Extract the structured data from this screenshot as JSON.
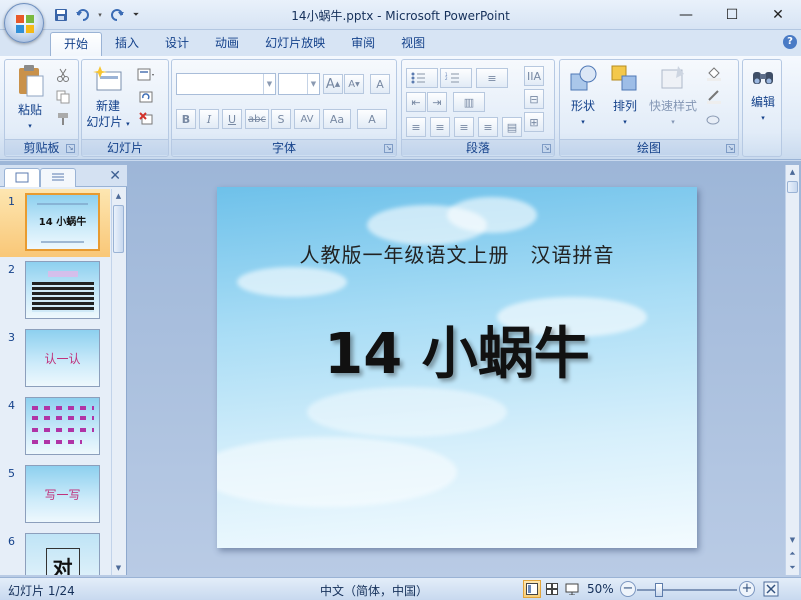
{
  "window": {
    "title": "14小蜗牛.pptx - Microsoft PowerPoint",
    "controls": [
      "minimize-icon",
      "maximize-icon",
      "close-icon"
    ]
  },
  "quick_access": [
    "save-icon",
    "undo-icon",
    "redo-icon",
    "customize-icon"
  ],
  "tabs": [
    {
      "label": "开始",
      "active": true
    },
    {
      "label": "插入",
      "active": false
    },
    {
      "label": "设计",
      "active": false
    },
    {
      "label": "动画",
      "active": false
    },
    {
      "label": "幻灯片放映",
      "active": false
    },
    {
      "label": "审阅",
      "active": false
    },
    {
      "label": "视图",
      "active": false
    }
  ],
  "ribbon": {
    "clipboard": {
      "label": "剪贴板",
      "paste": "粘贴"
    },
    "slides": {
      "label": "幻灯片",
      "new_slide_line1": "新建",
      "new_slide_line2": "幻灯片"
    },
    "font": {
      "label": "字体",
      "font_name": "",
      "font_size": "",
      "bold": "B",
      "italic": "I",
      "underline": "U",
      "strike": "abc",
      "shadow": "S",
      "spacing": "AV",
      "case": "Aa",
      "grow": "A",
      "shrink": "A",
      "color": "A"
    },
    "paragraph": {
      "label": "段落"
    },
    "drawing": {
      "label": "绘图",
      "shapes": "形状",
      "arrange": "排列",
      "quick_styles": "快速样式"
    },
    "editing": {
      "label": "编辑"
    }
  },
  "thumbnails": [
    {
      "number": "1",
      "active": true,
      "title": "14 小蜗牛"
    },
    {
      "number": "2",
      "active": false,
      "title": ""
    },
    {
      "number": "3",
      "active": false,
      "title": "认一认"
    },
    {
      "number": "4",
      "active": false,
      "title": ""
    },
    {
      "number": "5",
      "active": false,
      "title": "写一写"
    },
    {
      "number": "6",
      "active": false,
      "title": "对"
    }
  ],
  "slide": {
    "subtitle": "人教版一年级语文上册　汉语拼音",
    "title": "14 小蜗牛"
  },
  "statusbar": {
    "slide_info": "幻灯片 1/24",
    "language": "中文（简体，中国）",
    "zoom": "50%",
    "zoom_level": 0.5
  }
}
